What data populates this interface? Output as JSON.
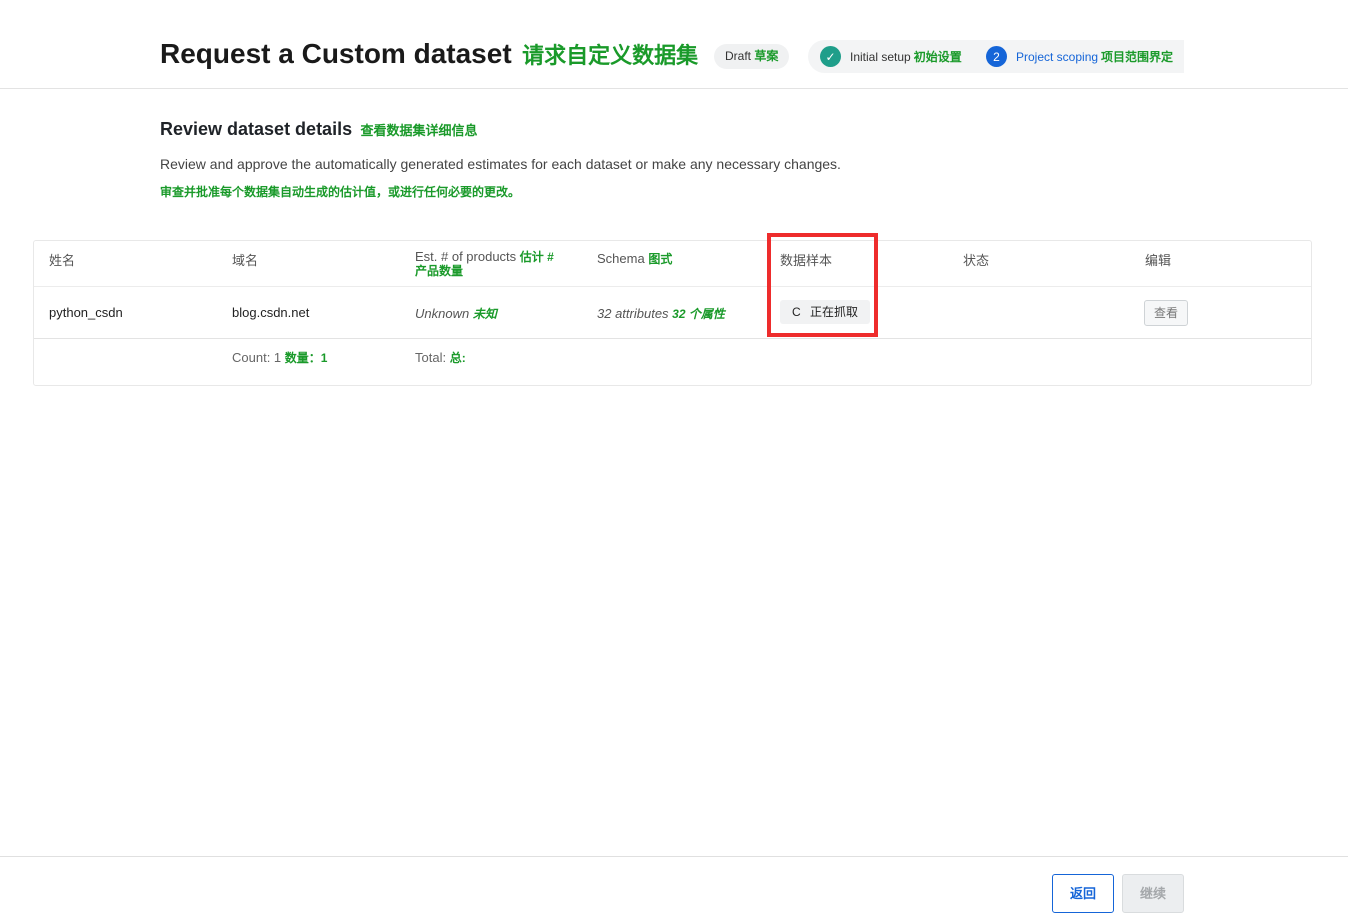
{
  "header": {
    "title_en": "Request a Custom dataset",
    "title_cn": "请求自定义数据集",
    "badge_en": "Draft",
    "badge_cn": "草案",
    "steps": [
      {
        "number": "✓",
        "label_en": "Initial setup",
        "label_cn": "初始设置"
      },
      {
        "number": "2",
        "label_en": "Project scoping",
        "label_cn": "项目范围界定"
      }
    ]
  },
  "section": {
    "title_en": "Review dataset details",
    "title_cn": "查看数据集详细信息",
    "desc_en": "Review and approve the automatically generated estimates for each dataset or make any necessary changes.",
    "desc_cn": "审查并批准每个数据集自动生成的估计值，或进行任何必要的更改。"
  },
  "table": {
    "headers": {
      "name": "姓名",
      "domain": "域名",
      "est_en": "Est. # of products",
      "est_cn": "估计 # 产品数量",
      "schema_en": "Schema",
      "schema_cn": "图式",
      "sample": "数据样本",
      "status": "状态",
      "edit": "编辑"
    },
    "row": {
      "name": "python_csdn",
      "domain": "blog.csdn.net",
      "est_en": "Unknown",
      "est_cn": "未知",
      "schema_en": "32 attributes",
      "schema_cn": "32 个属性",
      "sample_button": "正在抓取",
      "sample_spinner": "C",
      "view_button": "查看"
    },
    "footer": {
      "count_en": "Count: 1",
      "count_cn": "数量：1",
      "total_en": "Total:",
      "total_cn": "总:"
    }
  },
  "footer": {
    "back_label": "返回",
    "continue_label": "继续"
  },
  "colors": {
    "accent_blue": "#1565d8",
    "translation_green": "#1a9a2a",
    "highlight_red": "#ee2c2c",
    "step_done": "#1f9e8a"
  }
}
